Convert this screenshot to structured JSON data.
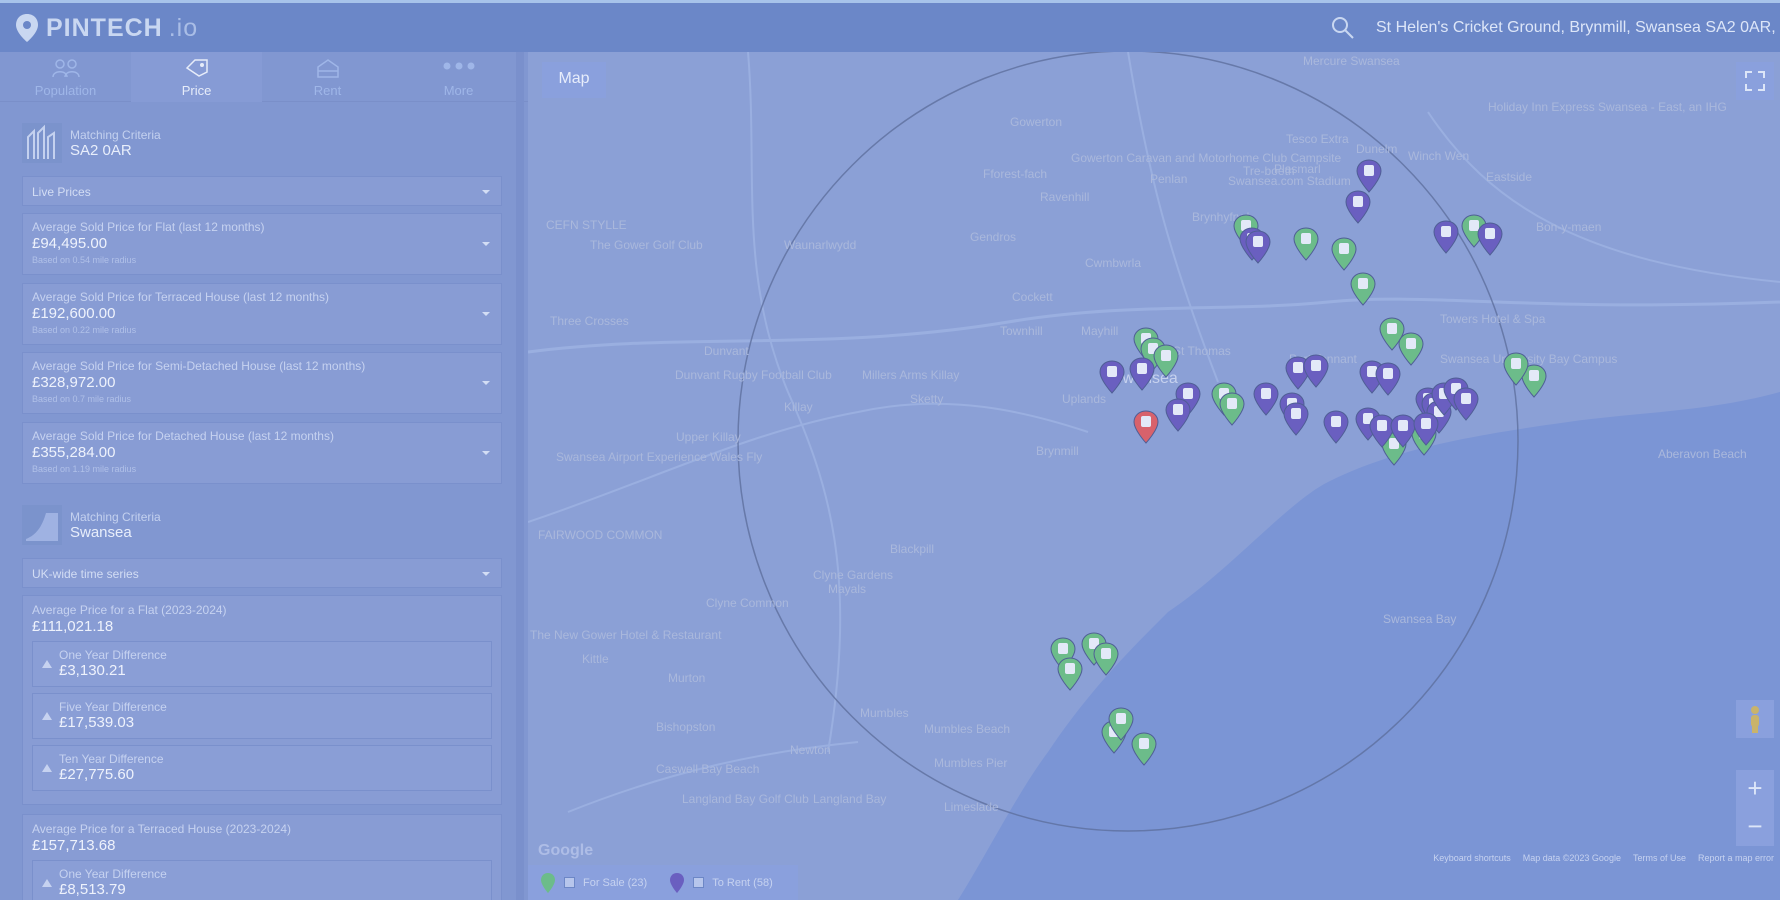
{
  "app": {
    "logo_main": "PINTECH",
    "logo_suffix": ".io"
  },
  "search": {
    "address": "St Helen's Cricket Ground, Brynmill, Swansea SA2 0AR, UK"
  },
  "tabs": [
    {
      "label": "Population",
      "icon": "people-icon"
    },
    {
      "label": "Price",
      "icon": "price-tag-icon"
    },
    {
      "label": "Rent",
      "icon": "house-icon"
    },
    {
      "label": "More",
      "icon": "dots-icon"
    }
  ],
  "section1": {
    "caption": "Matching Criteria",
    "title": "SA2 0AR",
    "dropdown": "Live Prices",
    "cards": [
      {
        "label": "Average Sold Price for Flat (last 12 months)",
        "value": "£94,495.00",
        "note": "Based on 0.54 mile radius"
      },
      {
        "label": "Average Sold Price for Terraced House (last 12 months)",
        "value": "£192,600.00",
        "note": "Based on 0.22 mile radius"
      },
      {
        "label": "Average Sold Price for Semi-Detached House (last 12 months)",
        "value": "£328,972.00",
        "note": "Based on 0.7 mile radius"
      },
      {
        "label": "Average Sold Price for Detached House (last 12 months)",
        "value": "£355,284.00",
        "note": "Based on 1.19 mile radius"
      }
    ]
  },
  "section2": {
    "caption": "Matching Criteria",
    "title": "Swansea",
    "dropdown": "UK-wide time series",
    "flat": {
      "label": "Average Price for a Flat (2023-2024)",
      "value": "£111,021.18",
      "diffs": [
        {
          "label": "One Year Difference",
          "value": "£3,130.21"
        },
        {
          "label": "Five Year Difference",
          "value": "£17,539.03"
        },
        {
          "label": "Ten Year Difference",
          "value": "£27,775.60"
        }
      ]
    },
    "terraced": {
      "label": "Average Price for a Terraced House (2023-2024)",
      "value": "£157,713.68",
      "diffs": [
        {
          "label": "One Year Difference",
          "value": "£8,513.79"
        }
      ]
    }
  },
  "map": {
    "type_label": "Map",
    "places": [
      "Gowerton",
      "Gowerton Caravan and Motorhome Club Campsite",
      "Tesco Extra",
      "Dunelm",
      "Fforest-fach",
      "Penlan",
      "Tre-boeth",
      "Plasmarl",
      "Winch Wen",
      "Eastside",
      "Ravenhill",
      "Swansea.com Stadium",
      "Brynhyfryd",
      "Bon-y-maen",
      "CEFN STYLLE",
      "The Gower Golf Club",
      "Waunarlwydd",
      "Gendros",
      "Cwmbwrla",
      "Cockett",
      "Three Crosses",
      "Dunvant",
      "Townhill",
      "Mayhill",
      "St Thomas",
      "Port Tennant",
      "Towers Hotel & Spa",
      "Swansea University Bay Campus",
      "Swansea",
      "Dunvant Rugby Football Club",
      "Killay",
      "Sketty",
      "Uplands",
      "Upper Killay",
      "Brynmill",
      "Swansea Airport Experience Wales Fly",
      "FAIRWOOD COMMON",
      "Clyne Gardens",
      "Clyne Common",
      "The New Gower Hotel & Restaurant",
      "Kittle",
      "Murton",
      "Bishopston",
      "Newton",
      "Caswell Bay Beach",
      "Langland Bay Golf Club",
      "Langland Bay",
      "Mumbles Beach",
      "Mumbles Pier",
      "Mercure Swansea",
      "Holiday Inn Express Swansea - East, an IHG",
      "Aberavon Beach",
      "Swansea Bay",
      "Millers Arms Killay",
      "Mayals",
      "Blackpill",
      "Mumbles",
      "Limeslade"
    ],
    "legend_for_sale": "For Sale (23)",
    "legend_to_rent": "To Rent (58)",
    "attribution": [
      "Keyboard shortcuts",
      "Map data ©2023 Google",
      "Terms of Use",
      "Report a map error"
    ],
    "google_logo": "Google",
    "colors": {
      "sale_pin": "#6cbc8a",
      "rent_pin": "#6a5fc0",
      "center_pin": "#d8626c",
      "sea": "#7b95d5"
    }
  }
}
